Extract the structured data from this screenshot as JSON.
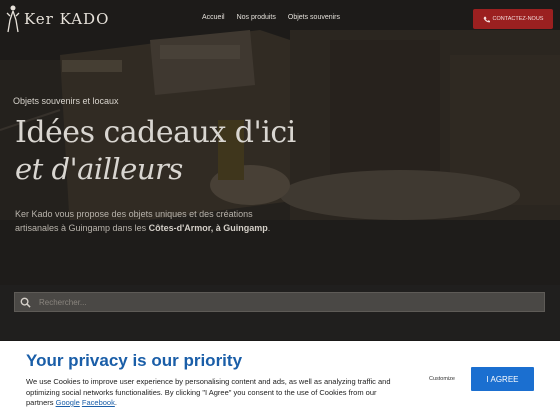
{
  "header": {
    "logo_text": "Ker KADO",
    "nav": [
      "Accueil",
      "Nos produits",
      "Objets souvenirs"
    ],
    "cta_label": "CONTACTEZ-NOUS"
  },
  "hero": {
    "eyebrow": "Objets souvenirs et locaux",
    "title_line1": "Idées cadeaux d'ici",
    "title_line2": "et d'ailleurs",
    "desc_prefix": "Ker Kado vous propose des objets uniques et des créations artisanales à Guingamp dans les ",
    "desc_bold": "Côtes-d'Armor, à Guingamp",
    "desc_suffix": "."
  },
  "search": {
    "placeholder": "Rechercher..."
  },
  "cookie": {
    "title": "Your privacy is our priority",
    "text": "We use Cookies to improve user experience by personalising content and ads, as well as analyzing traffic and optimizing social networks functionalities. By clicking \"I Agree\" you consent to the use of Cookies from our partners ",
    "link_google": "Google",
    "link_facebook": "Facebook",
    "customize_label": "Customize",
    "agree_label": "I AGREE"
  },
  "colors": {
    "accent_red": "#9b2020",
    "cookie_blue": "#1a5ea8",
    "agree_blue": "#1b6fd0"
  }
}
